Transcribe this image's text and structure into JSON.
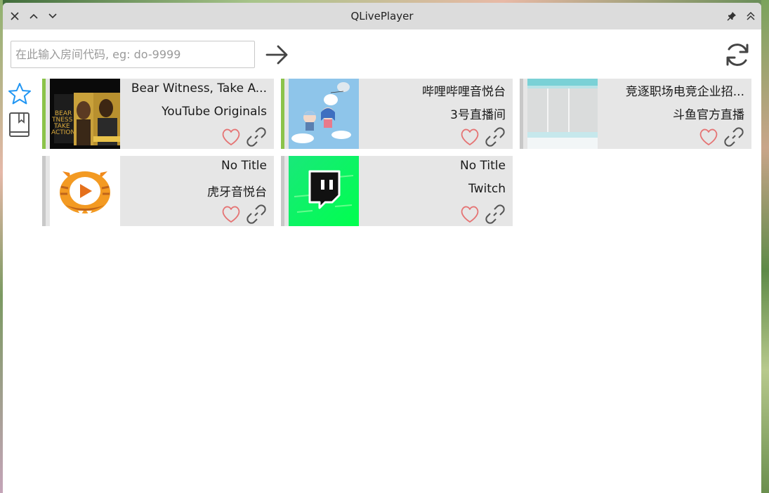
{
  "window": {
    "title": "QLivePlayer"
  },
  "search": {
    "placeholder": "在此输入房间代码, eg: do-9999",
    "value": ""
  },
  "icons": {
    "close": "close-icon",
    "up": "chevron-up-icon",
    "down": "chevron-down-icon",
    "pin": "pin-icon",
    "collapse": "double-chevron-up-icon",
    "go": "arrow-right-icon",
    "refresh": "refresh-icon",
    "favorites": "star-icon",
    "library": "book-icon",
    "like": "heart-icon",
    "link": "link-icon"
  },
  "colors": {
    "live_bar": "#8bc34a",
    "offline_bar": "#c8c8c8",
    "accent_star": "#2196f3",
    "heart": "#e57373"
  },
  "rooms": [
    {
      "title": "Bear Witness, Take A...",
      "channel": "YouTube Originals",
      "live": true
    },
    {
      "title": "哔哩哔哩音悦台",
      "channel": "3号直播间",
      "live": true
    },
    {
      "title": "竞逐职场电竞企业招...",
      "channel": "斗鱼官方直播",
      "live": false
    },
    {
      "title": "No Title",
      "channel": "虎牙音悦台",
      "live": false
    },
    {
      "title": "No Title",
      "channel": "Twitch",
      "live": false
    }
  ]
}
